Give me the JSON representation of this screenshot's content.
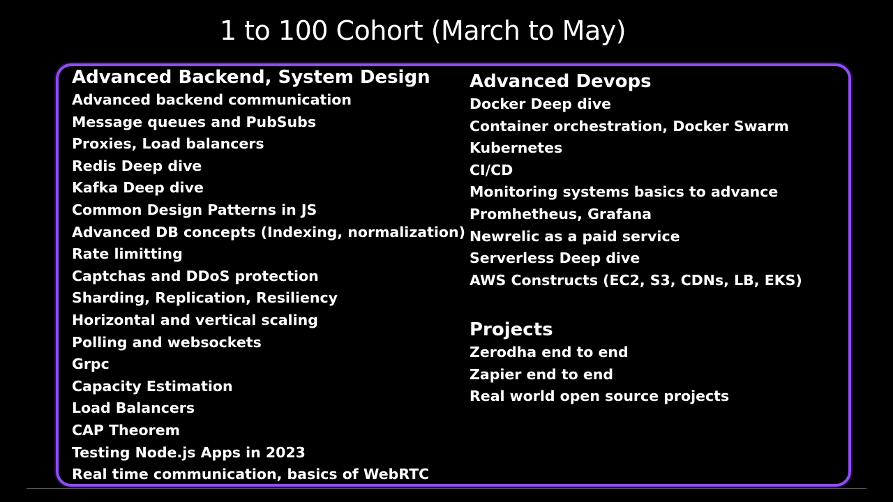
{
  "slide": {
    "title": "1 to 100 Cohort (March to May)",
    "accent_color": "#8e4ff0",
    "background_color": "#000000"
  },
  "backend": {
    "heading": "Advanced Backend, System Design",
    "items": [
      "Advanced backend communication",
      "Message queues and PubSubs",
      "Proxies, Load balancers",
      "Redis Deep dive",
      "Kafka Deep dive",
      "Common Design Patterns in JS",
      "Advanced DB concepts (Indexing, normalization)",
      "Rate limitting",
      "Captchas and DDoS protection",
      "Sharding, Replication, Resiliency",
      "Horizontal and vertical scaling",
      "Polling and websockets",
      "Grpc",
      "Capacity Estimation",
      "Load Balancers",
      "CAP Theorem",
      "Testing Node.js Apps in 2023",
      "Real time communication, basics of WebRTC"
    ]
  },
  "devops": {
    "heading": "Advanced Devops",
    "items": [
      "Docker Deep dive",
      "Container orchestration, Docker Swarm",
      "Kubernetes",
      "CI/CD",
      "Monitoring systems basics to advance",
      "Promhetheus, Grafana",
      "Newrelic as a paid service",
      "Serverless Deep dive",
      "AWS Constructs (EC2, S3, CDNs, LB, EKS)"
    ]
  },
  "projects": {
    "heading": "Projects",
    "items": [
      "Zerodha end to end",
      "Zapier end to end",
      "Real world open source projects"
    ]
  }
}
